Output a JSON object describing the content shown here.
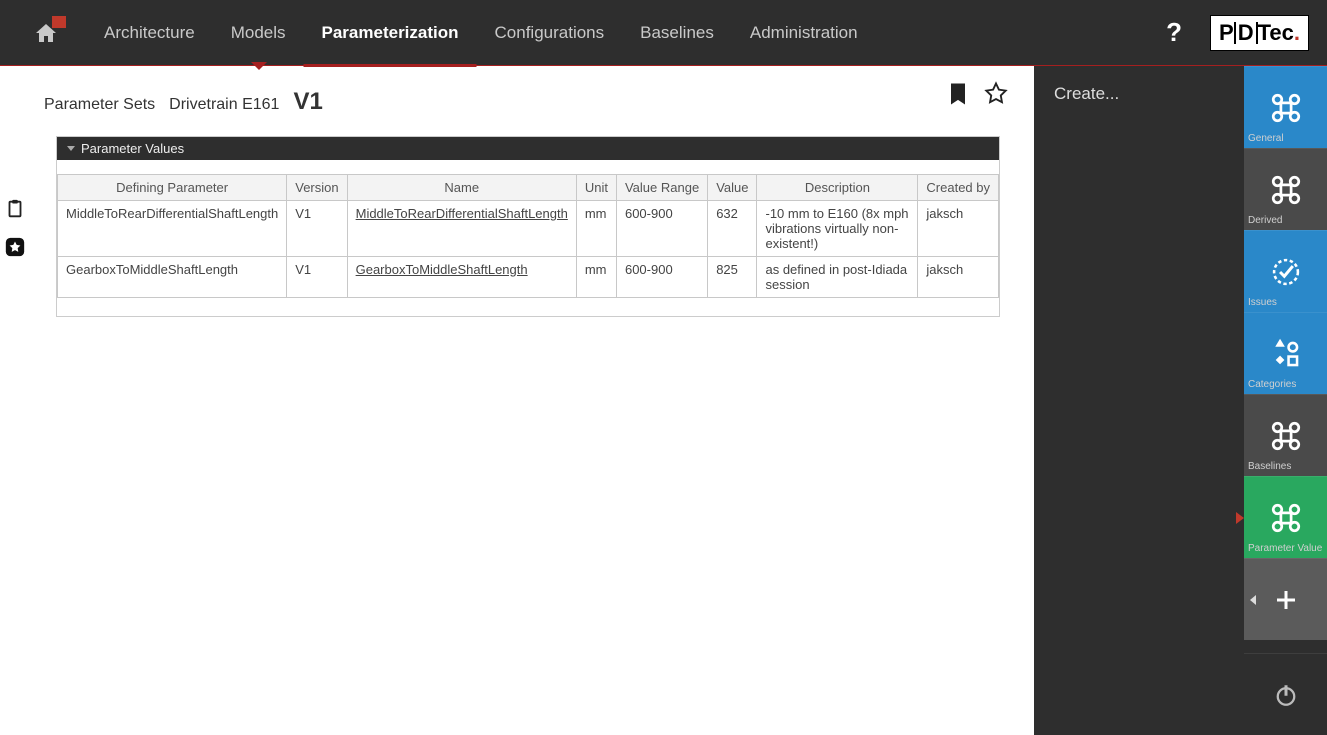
{
  "nav": {
    "items": [
      {
        "label": "Architecture",
        "active": false
      },
      {
        "label": "Models",
        "active": false
      },
      {
        "label": "Parameterization",
        "active": true
      },
      {
        "label": "Configurations",
        "active": false
      },
      {
        "label": "Baselines",
        "active": false
      },
      {
        "label": "Administration",
        "active": false
      }
    ],
    "help": "?",
    "logo_text": "P|D|Tec."
  },
  "breadcrumb": {
    "root": "Parameter Sets",
    "item": "Drivetrain E161",
    "version": "V1"
  },
  "panel": {
    "title": "Parameter Values",
    "columns": [
      "Defining Parameter",
      "Version",
      "Name",
      "Unit",
      "Value Range",
      "Value",
      "Description",
      "Created by"
    ],
    "rows": [
      {
        "def": "MiddleToRearDifferentialShaftLength",
        "version": "V1",
        "name": "MiddleToRearDifferentialShaftLength",
        "unit": "mm",
        "range": "600-900",
        "value": "632",
        "desc": "-10 mm to E160 (8x mph vibrations virtually non-existent!)",
        "by": "jaksch"
      },
      {
        "def": "GearboxToMiddleShaftLength",
        "version": "V1",
        "name": "GearboxToMiddleShaftLength",
        "unit": "mm",
        "range": "600-900",
        "value": "825",
        "desc": "as defined in post-Idiada session",
        "by": "jaksch"
      }
    ]
  },
  "side": {
    "create": "Create..."
  },
  "rail": {
    "items": [
      {
        "label": "General",
        "variant": "blue",
        "icon": "cmd"
      },
      {
        "label": "Derived",
        "variant": "gray",
        "icon": "cmd"
      },
      {
        "label": "Issues",
        "variant": "blue",
        "icon": "check"
      },
      {
        "label": "Categories",
        "variant": "blue",
        "icon": "grid"
      },
      {
        "label": "Baselines",
        "variant": "gray",
        "icon": "cmd"
      },
      {
        "label": "Parameter Value",
        "variant": "green",
        "icon": "cmd"
      },
      {
        "label": "",
        "variant": "dark",
        "icon": "plus"
      }
    ]
  }
}
